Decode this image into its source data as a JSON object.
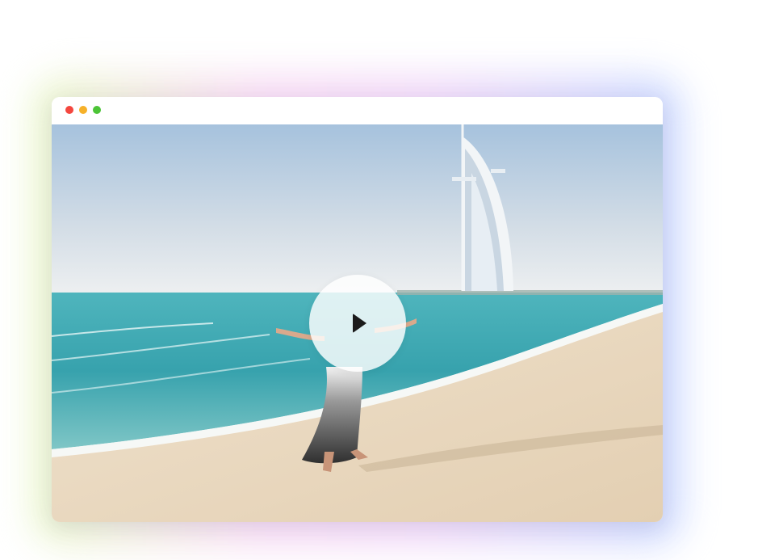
{
  "window": {
    "controls": [
      {
        "name": "close",
        "color": "#f4473f"
      },
      {
        "name": "minimize",
        "color": "#f6b129"
      },
      {
        "name": "maximize",
        "color": "#4cc437"
      }
    ]
  },
  "video": {
    "scene": "beach-with-sail-shaped-hotel",
    "play_icon": "play-icon",
    "colors": {
      "sky_top": "#a7c3de",
      "sky_bottom": "#e8ecef",
      "sea": "#3fa9b3",
      "sand": "#e9d8bf"
    }
  }
}
